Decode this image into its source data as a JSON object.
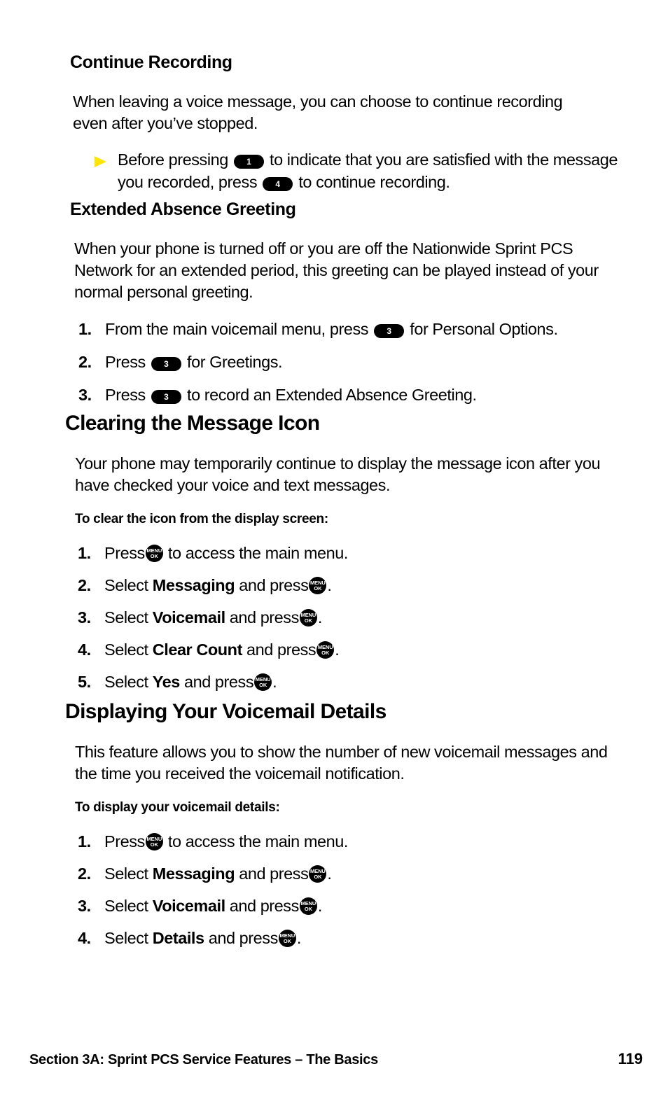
{
  "page": {
    "background": "#ffffff",
    "bullet_color": "#FFE500",
    "key_color": "#000000"
  },
  "sections": {
    "continue_recording": {
      "heading": "Continue Recording",
      "paragraph": "When leaving a voice message, you can choose to continue recording even after you’ve stopped.",
      "bullet": {
        "icon": "triangle-right-icon",
        "text_1": "Before pressing",
        "key_1": "1",
        "text_2": "to indicate that you are satisfied with the message you recorded, press",
        "key_2": "4",
        "text_3": "to continue recording."
      }
    },
    "extended_absence": {
      "heading": "Extended Absence Greeting",
      "paragraph": "When your phone is turned off or you are off the Nationwide Sprint PCS Network for an extended period, this greeting can be played instead of your normal personal greeting.",
      "steps": [
        {
          "num": "1.",
          "pre": "From the main voicemail menu, press",
          "key": "3",
          "post": "for Personal Options."
        },
        {
          "num": "2.",
          "pre": "Press",
          "key": "3",
          "post": "for Greetings."
        },
        {
          "num": "3.",
          "pre": "Press",
          "key": "3",
          "post": "to record an Extended Absence Greeting."
        }
      ]
    },
    "clearing_message_icon": {
      "heading": "Clearing the Message Icon",
      "paragraph": "Your phone may temporarily continue to display the message icon after you have checked your voice and text messages.",
      "runin": "To clear the icon from the display screen:",
      "steps": [
        {
          "num": "1.",
          "pre": "Press",
          "key": "menu-ok",
          "bold": "",
          "mid": "",
          "post": "to access the main menu."
        },
        {
          "num": "2.",
          "pre": "Select",
          "bold": "Messaging",
          "mid": "and press",
          "key": "menu-ok",
          "post": "."
        },
        {
          "num": "3.",
          "pre": "Select",
          "bold": "Voicemail",
          "mid": "and press",
          "key": "menu-ok",
          "post": "."
        },
        {
          "num": "4.",
          "pre": "Select",
          "bold": "Clear Count",
          "mid": "and press",
          "key": "menu-ok",
          "post": "."
        },
        {
          "num": "5.",
          "pre": "Select",
          "bold": "Yes",
          "mid": "and press",
          "key": "menu-ok",
          "post": "."
        }
      ]
    },
    "displaying_voicemail_details": {
      "heading": "Displaying Your Voicemail Details",
      "paragraph": "This feature allows you to show the number of new voicemail messages and the time you received the voicemail notification.",
      "runin": "To display your voicemail details:",
      "steps": [
        {
          "num": "1.",
          "pre": "Press",
          "key": "menu-ok",
          "bold": "",
          "mid": "",
          "post": "to access the main menu."
        },
        {
          "num": "2.",
          "pre": "Select",
          "bold": "Messaging",
          "mid": "and press",
          "key": "menu-ok",
          "post": "."
        },
        {
          "num": "3.",
          "pre": "Select",
          "bold": "Voicemail",
          "mid": "and press",
          "key": "menu-ok",
          "post": "."
        },
        {
          "num": "4.",
          "pre": "Select",
          "bold": "Details",
          "mid": "and press",
          "key": "menu-ok",
          "post": "."
        }
      ]
    }
  },
  "key_labels": {
    "menu_top": "MENU",
    "menu_bottom": "OK"
  },
  "footer": {
    "section_text": "Section 3A: Sprint PCS Service Features – The Basics",
    "page_number": "119"
  }
}
